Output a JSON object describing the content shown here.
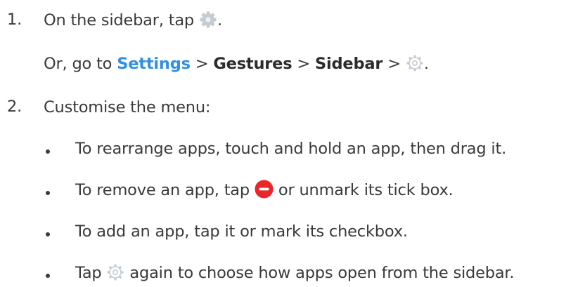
{
  "steps": [
    {
      "number": "1.",
      "text_before_icon": "On the sidebar, tap",
      "icon": "gear-solid-icon",
      "text_after_icon": ".",
      "alt": {
        "prefix": "Or, go to ",
        "settings": "Settings",
        "sep1": " > ",
        "gestures": "Gestures",
        "sep2": " > ",
        "sidebar": "Sidebar",
        "sep3": " > ",
        "icon": "gear-outline-icon",
        "suffix": "."
      }
    },
    {
      "number": "2.",
      "text": "Customise the menu:",
      "bullets": [
        {
          "text": "To rearrange apps, touch and hold an app, then drag it."
        },
        {
          "before": "To remove an app, tap ",
          "icon": "remove-icon",
          "after": " or unmark its tick box."
        },
        {
          "text": "To add an app, tap it or mark its checkbox."
        },
        {
          "before": "Tap ",
          "icon": "gear-outline-icon",
          "after": " again to choose how apps open from the sidebar."
        }
      ]
    }
  ],
  "colors": {
    "text": "#3a3a3a",
    "link": "#2f8fe6",
    "remove_icon": "#e8262b",
    "gear_icon": "#b8c4cc"
  }
}
